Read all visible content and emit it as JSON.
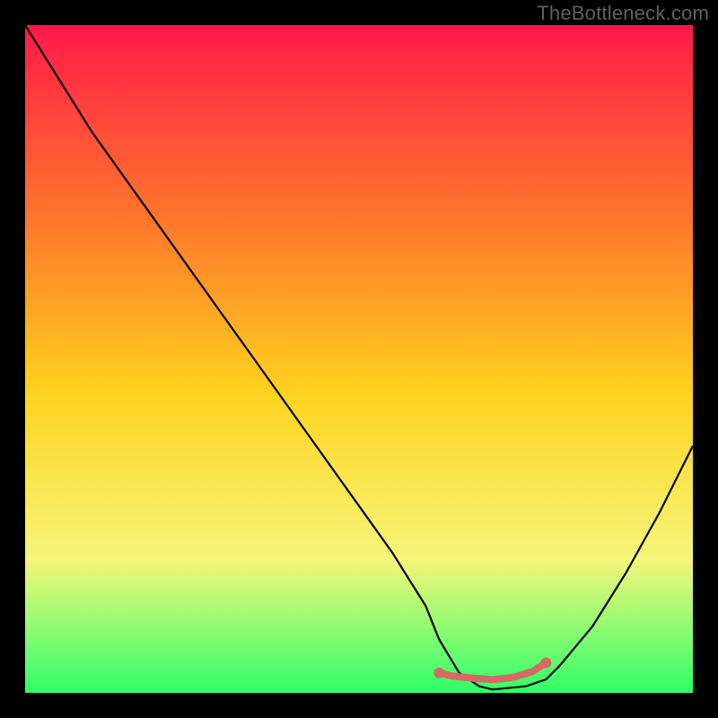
{
  "watermark": "TheBottleneck.com",
  "chart_data": {
    "type": "line",
    "title": "",
    "xlabel": "",
    "ylabel": "",
    "xlim": [
      0,
      100
    ],
    "ylim": [
      0,
      100
    ],
    "grid": false,
    "legend": false,
    "background_gradient": {
      "top": "#ff1a4a",
      "upper_mid": "#ff7a2a",
      "mid": "#ffd21f",
      "lower_mid": "#f6f67a",
      "bottom": "#2dff6a"
    },
    "series": [
      {
        "name": "bottleneck-curve",
        "stroke": "#000000",
        "x": [
          0,
          5,
          10,
          15,
          20,
          25,
          30,
          35,
          40,
          45,
          50,
          55,
          60,
          62,
          65,
          68,
          70,
          75,
          78,
          80,
          85,
          90,
          95,
          100
        ],
        "values": [
          100,
          92,
          84,
          77,
          70,
          63,
          56,
          49,
          42,
          35,
          28,
          21,
          13,
          8,
          3,
          1,
          0.5,
          1,
          2,
          4,
          10,
          18,
          27,
          37
        ]
      },
      {
        "name": "optimal-range-marker",
        "stroke": "#d46a63",
        "marker_points": [
          {
            "x": 62,
            "y": 3.0
          },
          {
            "x": 64,
            "y": 2.5
          },
          {
            "x": 67,
            "y": 2.2
          },
          {
            "x": 70,
            "y": 2.0
          },
          {
            "x": 73,
            "y": 2.3
          },
          {
            "x": 76,
            "y": 3.2
          },
          {
            "x": 78,
            "y": 4.5
          }
        ],
        "endpoint_dots": [
          {
            "x": 62,
            "y": 3.0
          },
          {
            "x": 78,
            "y": 4.5
          }
        ]
      }
    ]
  }
}
